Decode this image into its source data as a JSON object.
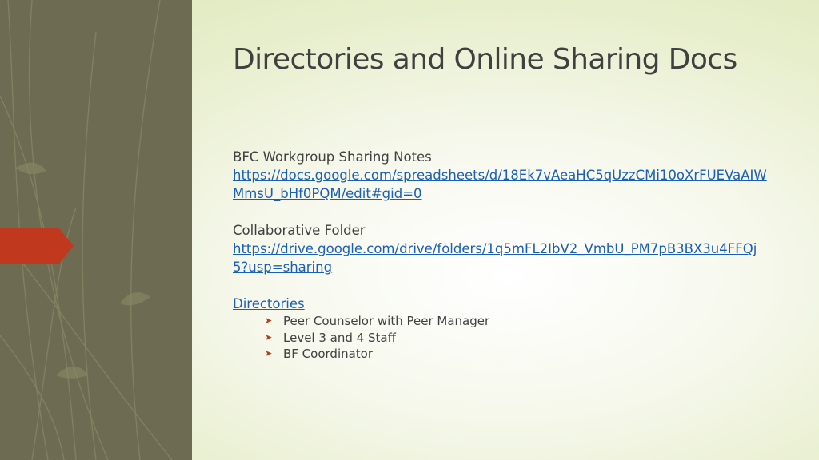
{
  "slide": {
    "title": "Directories and Online Sharing Docs",
    "sections": [
      {
        "heading": "BFC Workgroup Sharing Notes",
        "link": "https://docs.google.com/spreadsheets/d/18Ek7vAeaHC5qUzzCMi10oXrFUEVaAIWMmsU_bHf0PQM/edit#gid=0"
      },
      {
        "heading": "Collaborative Folder",
        "link": "https://drive.google.com/drive/folders/1q5mFL2IbV2_VmbU_PM7pB3BX3u4FFQj5?usp=sharing"
      }
    ],
    "directories": {
      "label": "Directories",
      "items": [
        "Peer Counselor with Peer Manager",
        "Level 3 and 4 Staff",
        "BF Coordinator"
      ]
    }
  },
  "colors": {
    "side_panel": "#6d6b52",
    "accent_arrow": "#c0391f",
    "link": "#1a5fb4",
    "text": "#404040"
  },
  "icons": {
    "bullet": "arrow-bullet-icon"
  }
}
